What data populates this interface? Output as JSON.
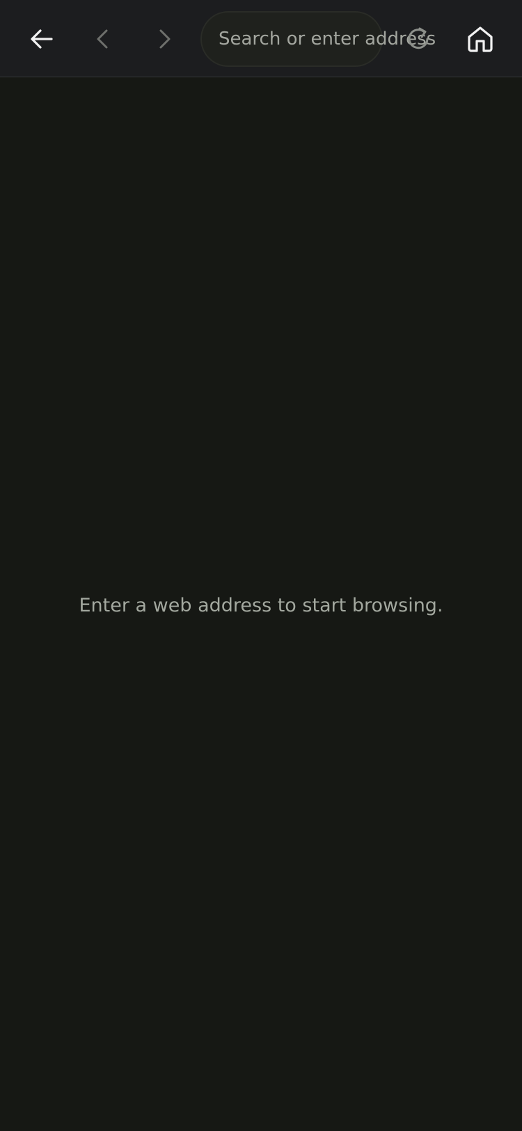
{
  "toolbar": {
    "address_placeholder": "Search or enter address",
    "address_value": "",
    "buttons": {
      "exit": {
        "icon": "arrow-left-icon"
      },
      "back": {
        "icon": "chevron-left-icon",
        "enabled": false
      },
      "forward": {
        "icon": "chevron-right-icon",
        "enabled": false
      },
      "reload": {
        "icon": "reload-icon"
      },
      "home": {
        "icon": "home-icon"
      }
    }
  },
  "content": {
    "empty_message": "Enter a web address to start browsing."
  },
  "colors": {
    "toolbar_bg": "#1c1d1f",
    "page_bg": "#161814",
    "icon_active": "#f2f2f2",
    "icon_disabled": "#6e706c",
    "muted_text": "#a3a89f"
  }
}
